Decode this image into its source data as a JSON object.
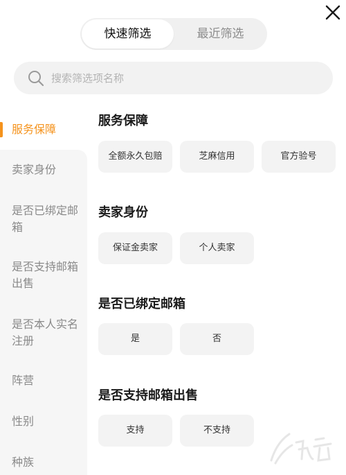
{
  "header": {
    "tabs": [
      {
        "label": "快速筛选",
        "active": true
      },
      {
        "label": "最近筛选",
        "active": false
      }
    ]
  },
  "search": {
    "placeholder": "搜索筛选项名称"
  },
  "sidebar": {
    "items": [
      {
        "label": "服务保障",
        "active": true
      },
      {
        "label": "卖家身份"
      },
      {
        "label": "是否已绑定邮箱"
      },
      {
        "label": "是否支持邮箱出售"
      },
      {
        "label": "是否本人实名注册"
      },
      {
        "label": "阵营"
      },
      {
        "label": "性别"
      },
      {
        "label": "种族"
      }
    ]
  },
  "sections": [
    {
      "title": "服务保障",
      "options": [
        "全额永久包赔",
        "芝麻信用",
        "官方验号"
      ]
    },
    {
      "title": "卖家身份",
      "options": [
        "保证金卖家",
        "个人卖家"
      ]
    },
    {
      "title": "是否已绑定邮箱",
      "options": [
        "是",
        "否"
      ]
    },
    {
      "title": "是否支持邮箱出售",
      "options": [
        "支持",
        "不支持"
      ]
    }
  ],
  "colors": {
    "accent": "#f5931d",
    "chip_bg": "#f3f3f3",
    "sidebar_bg": "#f6f6f6"
  }
}
